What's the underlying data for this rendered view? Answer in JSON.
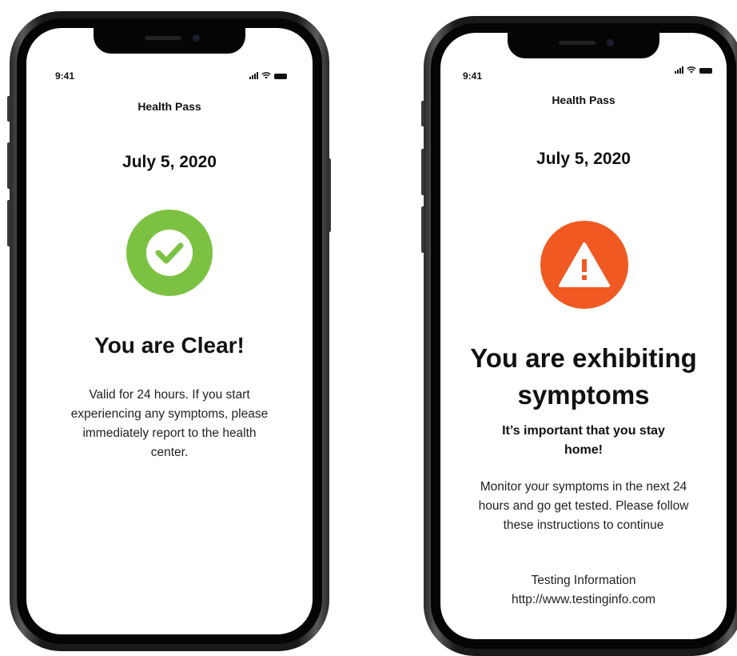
{
  "colors": {
    "clear_green": "#7cc242",
    "warning_orange": "#f05a22",
    "text_dark": "#111111"
  },
  "left_phone": {
    "status_time": "9:41",
    "nav_title": "Health Pass",
    "date": "July 5, 2020",
    "status_icon": "checkmark-icon",
    "headline": "You are Clear!",
    "body": "Valid for 24 hours. If you start experiencing any symptoms, please immediately report to the health center."
  },
  "right_phone": {
    "status_time": "9:41",
    "nav_title": "Health Pass",
    "date": "July 5, 2020",
    "status_icon": "warning-icon",
    "headline": "You are exhibiting symptoms",
    "subheadline": "It’s important that you stay home!",
    "body": "Monitor your symptoms in the next 24 hours and go get tested. Please follow these instructions to continue",
    "testing_label": "Testing Information",
    "testing_link": "http://www.testinginfo.com"
  }
}
